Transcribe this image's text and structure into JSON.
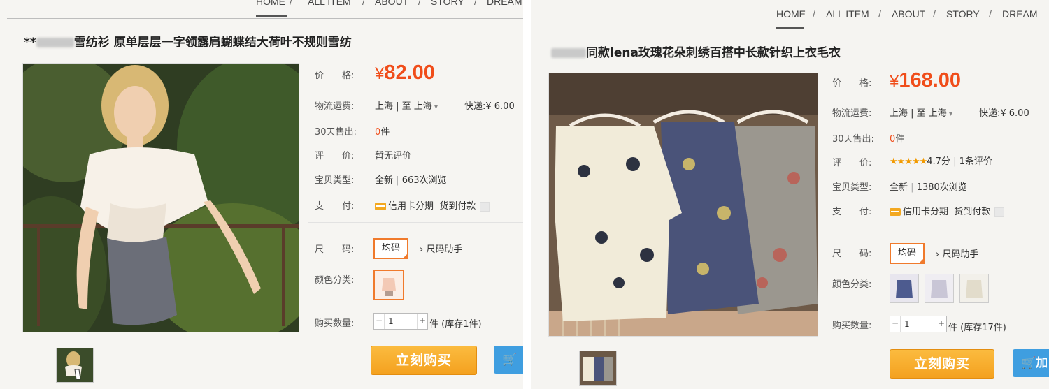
{
  "left": {
    "nav": [
      "HOME",
      "ALL ITEM",
      "ABOUT",
      "STORY",
      "DREAM"
    ],
    "title_prefix": "**",
    "title": "雪纺衫 原单层层一字领露肩蝴蝶结大荷叶不规则雪纺",
    "price_label": "价　　格:",
    "price_currency": "¥",
    "price": "82.00",
    "shipping_label": "物流运费:",
    "shipping_value": "上海 | 至 上海",
    "shipping_express": "快递:¥ 6.00",
    "sold_label": "30天售出:",
    "sold_count": "0",
    "sold_unit": "件",
    "rating_label": "评　　价:",
    "rating_value": "暂无评价",
    "type_label": "宝贝类型:",
    "type_value": "全新",
    "views": "663次浏览",
    "pay_label": "支　　付:",
    "pay_credit": "信用卡分期",
    "pay_cod": "货到付款",
    "size_label": "尺　　码:",
    "size_value": "均码",
    "size_helper": "› 尺码助手",
    "color_label": "颜色分类:",
    "qty_label": "购买数量:",
    "qty_value": "1",
    "qty_unit": "件",
    "stock": "(库存1件)",
    "buy_label": "立刻购买",
    "cart_label": "加"
  },
  "right": {
    "nav": [
      "HOME",
      "ALL ITEM",
      "ABOUT",
      "STORY",
      "DREAM"
    ],
    "title": "同款lena玫瑰花朵刺绣百搭中长款针织上衣毛衣",
    "price_label": "价　　格:",
    "price_currency": "¥",
    "price": "168.00",
    "shipping_label": "物流运费:",
    "shipping_value": "上海 | 至 上海",
    "shipping_express": "快递:¥ 6.00",
    "sold_label": "30天售出:",
    "sold_count": "0",
    "sold_unit": "件",
    "rating_label": "评　　价:",
    "rating_stars": "★★★★★",
    "rating_score": "4.7分",
    "rating_count": "1条评价",
    "type_label": "宝贝类型:",
    "type_value": "全新",
    "views": "1380次浏览",
    "pay_label": "支　　付:",
    "pay_credit": "信用卡分期",
    "pay_cod": "货到付款",
    "size_label": "尺　　码:",
    "size_value": "均码",
    "size_helper": "› 尺码助手",
    "color_label": "颜色分类:",
    "qty_label": "购买数量:",
    "qty_value": "1",
    "qty_unit": "件",
    "stock": "(库存17件)",
    "buy_label": "立刻购买",
    "cart_label": "加"
  },
  "colors": {
    "price": "#f04d1a",
    "buy_button": "#f4a11f",
    "cart_button": "#3f9ee0",
    "selected_border": "#f07a2c"
  }
}
